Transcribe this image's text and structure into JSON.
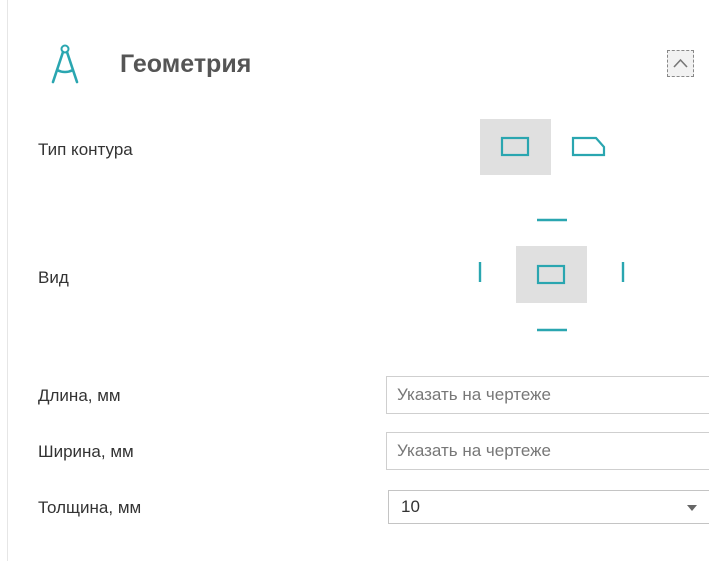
{
  "header": {
    "title": "Геометрия"
  },
  "contour": {
    "label": "Тип контура"
  },
  "view": {
    "label": "Вид"
  },
  "length": {
    "label": "Длина, мм",
    "placeholder": "Указать на чертеже"
  },
  "width": {
    "label": "Ширина, мм",
    "placeholder": "Указать на чертеже"
  },
  "thickness": {
    "label": "Толщина, мм",
    "value": "10"
  },
  "colors": {
    "accent": "#2aa6b0",
    "selected_bg": "#e0e0e0"
  }
}
